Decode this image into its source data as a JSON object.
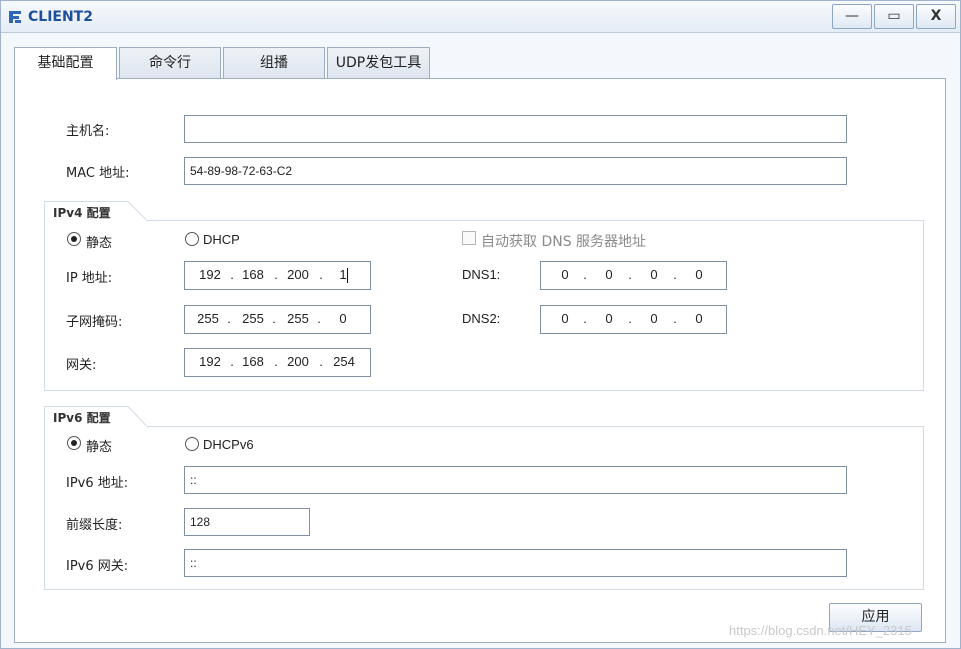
{
  "window": {
    "title": "CLIENT2",
    "minimize": "—",
    "maximize": "▭",
    "close": "X"
  },
  "tabs": [
    {
      "label": "基础配置",
      "active": true
    },
    {
      "label": "命令行",
      "active": false
    },
    {
      "label": "组播",
      "active": false
    },
    {
      "label": "UDP发包工具",
      "active": false
    }
  ],
  "basic": {
    "hostname_label": "主机名:",
    "hostname_value": "",
    "mac_label": "MAC 地址:",
    "mac_value": "54-89-98-72-63-C2"
  },
  "ipv4": {
    "group_title": "IPv4 配置",
    "static_label": "静态",
    "dhcp_label": "DHCP",
    "auto_dns_label": "自动获取 DNS 服务器地址",
    "ip_label": "IP 地址:",
    "ip": [
      "192",
      "168",
      "200",
      "1"
    ],
    "mask_label": "子网掩码:",
    "mask": [
      "255",
      "255",
      "255",
      "0"
    ],
    "gateway_label": "网关:",
    "gateway": [
      "192",
      "168",
      "200",
      "254"
    ],
    "dns1_label": "DNS1:",
    "dns1": [
      "0",
      "0",
      "0",
      "0"
    ],
    "dns2_label": "DNS2:",
    "dns2": [
      "0",
      "0",
      "0",
      "0"
    ]
  },
  "ipv6": {
    "group_title": "IPv6 配置",
    "static_label": "静态",
    "dhcp_label": "DHCPv6",
    "address_label": "IPv6 地址:",
    "address_value": "::",
    "prefix_label": "前缀长度:",
    "prefix_value": "128",
    "gateway_label": "IPv6 网关:",
    "gateway_value": "::"
  },
  "apply_label": "应用",
  "watermark": "https://blog.csdn.net/HEY_2315"
}
